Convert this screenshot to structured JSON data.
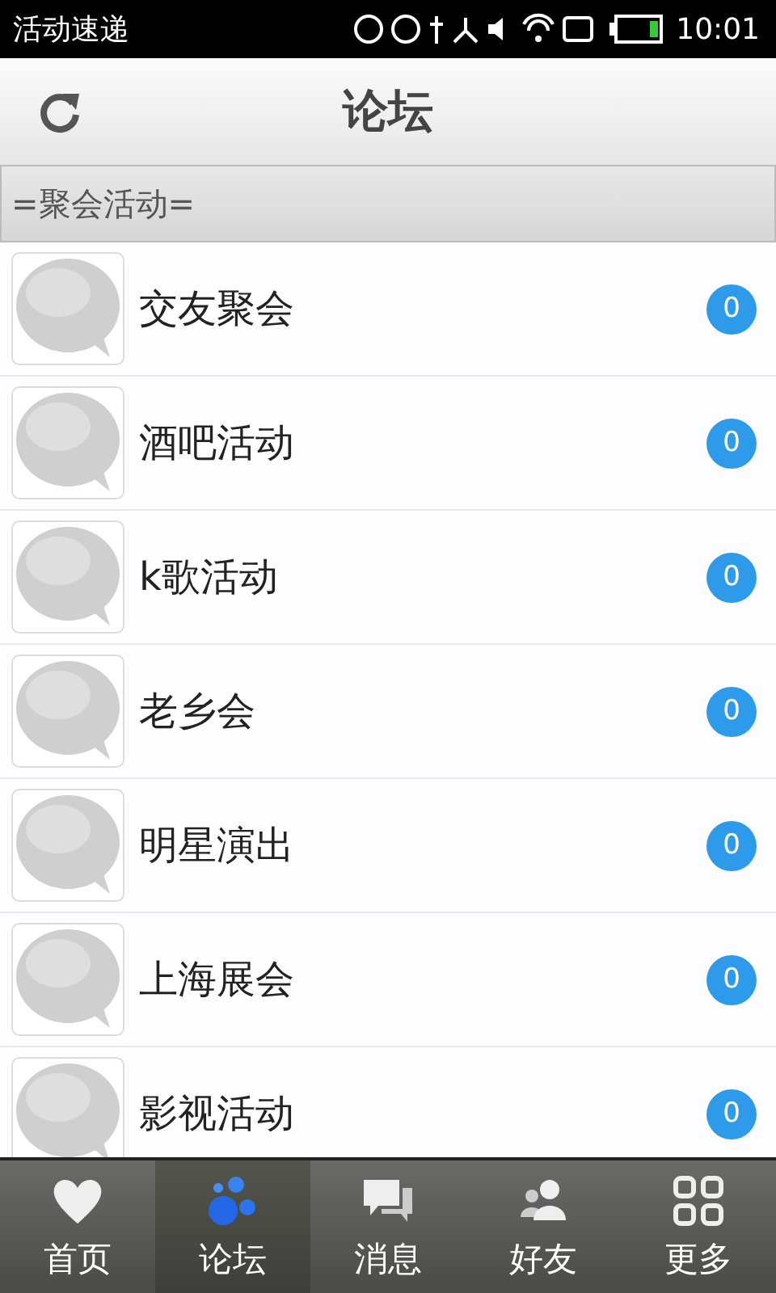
{
  "status_bar": {
    "app_name": "活动速递",
    "time": "10:01"
  },
  "header": {
    "title": "论坛"
  },
  "section": {
    "title": "=聚会活动="
  },
  "forums": [
    {
      "name": "交友聚会",
      "count": "0"
    },
    {
      "name": "酒吧活动",
      "count": "0"
    },
    {
      "name": "k歌活动",
      "count": "0"
    },
    {
      "name": "老乡会",
      "count": "0"
    },
    {
      "name": "明星演出",
      "count": "0"
    },
    {
      "name": "上海展会",
      "count": "0"
    },
    {
      "name": "影视活动",
      "count": "0"
    }
  ],
  "tabs": [
    {
      "label": "首页",
      "kind": "heart",
      "selected": false
    },
    {
      "label": "论坛",
      "kind": "paw",
      "selected": true
    },
    {
      "label": "消息",
      "kind": "chat",
      "selected": false
    },
    {
      "label": "好友",
      "kind": "people",
      "selected": false
    },
    {
      "label": "更多",
      "kind": "grid",
      "selected": false
    }
  ]
}
